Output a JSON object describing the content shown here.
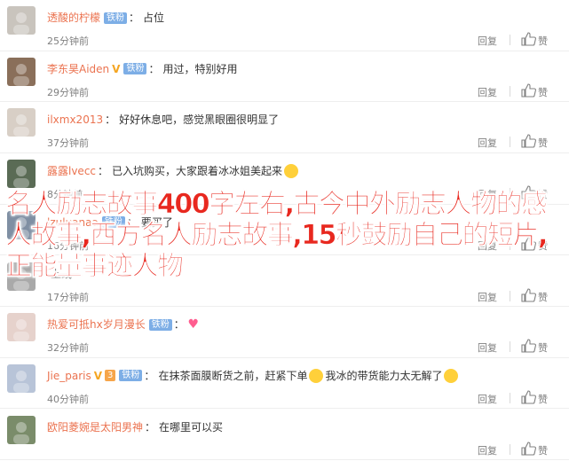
{
  "comments": [
    {
      "user": "透酸的柠檬",
      "verified": false,
      "level": "",
      "fan_badge": "铁粉",
      "text": "占位",
      "emoji_after": "",
      "time": "25分钟前",
      "reply": "回复",
      "like": "赞"
    },
    {
      "user": "李东昊Aiden",
      "verified": true,
      "level": "",
      "fan_badge": "铁粉",
      "text": "用过，特别好用",
      "emoji_after": "",
      "time": "29分钟前",
      "reply": "回复",
      "like": "赞"
    },
    {
      "user": "ilxmx2013",
      "verified": false,
      "level": "",
      "fan_badge": "",
      "text": "好好休息吧，感觉黑眼圈很明显了",
      "emoji_after": "",
      "time": "37分钟前",
      "reply": "回复",
      "like": "赞"
    },
    {
      "user": "露露lvecc",
      "verified": false,
      "level": "",
      "fan_badge": "",
      "text": "已入坑购买，大家跟着冰冰姐美起来",
      "emoji_after": "grin-emoji",
      "time": "8分钟前",
      "reply": "回复",
      "like": "赞"
    },
    {
      "user": "lzuluanaa",
      "verified": false,
      "level": "",
      "fan_badge": "铁粉",
      "text": "要买了",
      "emoji_after": "",
      "time": "16分钟前",
      "reply": "回复",
      "like": "赞"
    },
    {
      "user": "",
      "verified": false,
      "level": "",
      "fan_badge": "",
      "text": "上线",
      "emoji_after": "",
      "time": "17分钟前",
      "reply": "回复",
      "like": "赞"
    },
    {
      "user": "热爱可抵hx岁月漫长",
      "verified": false,
      "level": "",
      "fan_badge": "铁粉",
      "text": "",
      "emoji_after": "heart-emoji",
      "time": "32分钟前",
      "reply": "回复",
      "like": "赞"
    },
    {
      "user": "Jie_paris",
      "verified": true,
      "level": "3",
      "fan_badge": "铁粉",
      "text": "在抹茶面膜断货之前，赶紧下单",
      "text2": "我冰的带货能力太无解了",
      "emoji_after": "",
      "time": "40分钟前",
      "reply": "回复",
      "like": "赞"
    },
    {
      "user": "欧阳菱婉是太阳男神",
      "verified": false,
      "level": "",
      "fan_badge": "",
      "text": "在哪里可以买",
      "emoji_after": "",
      "time": "",
      "reply": "回复",
      "like": "赞"
    }
  ],
  "overlay_title": "名人励志故事400字左右,古今中外励志人物的感人故事,西方名人励志故事,15秒鼓励自己的短片,正能量事迹人物",
  "colors": {
    "username": "#eb7350",
    "overlay": "#e8281f",
    "fan_badge": "#7daee6",
    "muted": "#808080"
  }
}
